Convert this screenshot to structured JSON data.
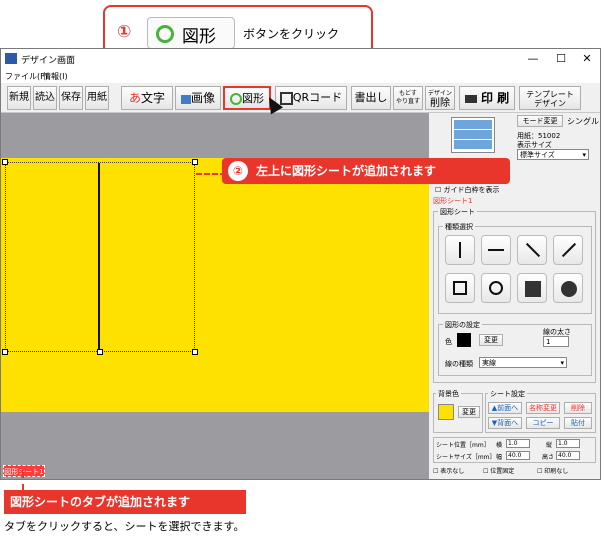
{
  "callout_top": {
    "num": "①",
    "button_label": "図形",
    "text": "ボタンをクリック"
  },
  "callout_mid": {
    "num": "②",
    "text": "左上に図形シートが追加されます"
  },
  "window": {
    "title": "デザイン画面",
    "controls": [
      "—",
      "☐",
      "✕"
    ]
  },
  "menu": {
    "file": "ファイル(F)",
    "info": "情報(I)"
  },
  "toolbar": {
    "new": "新規",
    "open": "読込",
    "save": "保存",
    "paper": "用紙",
    "text_prefix": "あ",
    "text": "文字",
    "image": "画像",
    "figure": "図形",
    "qr": "QRコード",
    "extract": "書出し",
    "back_top": "もどす",
    "back_bottom": "やり直す",
    "delete_top": "デザイン",
    "delete_bottom": "削除",
    "print": "印 刷",
    "template_top": "テンプレート",
    "template_bottom": "デザイン"
  },
  "panel": {
    "mode_button": "モード変更",
    "mode_value": "シングル",
    "paper_line": "用紙：51002",
    "display_size_label": "表示サイズ",
    "display_size_value": "標準サイズ",
    "guide_checkbox": "ガイド白枠を表示",
    "sheet_tab": "図形シート1",
    "figure_sheet": "図形シート",
    "type_select": "種類選択",
    "figure_settings": "図形の設定",
    "color_label": "色",
    "change": "変更",
    "line_width_label": "線の太さ",
    "line_width_value": "1",
    "line_type_label": "線の種類",
    "line_type_value": "実線",
    "bg_color": "背景色",
    "bg_change": "変更",
    "sheet_settings": "シート設定",
    "front": "▲前面へ",
    "back": "▼背面へ",
    "rename": "名称変更",
    "copy": "コピー",
    "delete": "削除",
    "paste": "貼付",
    "pos_label": "シート位置［mm］",
    "size_label": "シートサイズ［mm］",
    "x_label": "横",
    "x_value": "1.0",
    "y_label": "縦",
    "y_value": "1.0",
    "w_label": "幅",
    "w_value": "40.0",
    "h_label": "高さ",
    "h_value": "40.0",
    "hide": "表示なし",
    "fix_pos": "位置固定",
    "no_print": "印刷なし"
  },
  "bottom_tab": "図形シート1",
  "footer": {
    "highlight": "図形シートのタブが追加されます",
    "note": "タブをクリックすると、シートを選択できます。"
  },
  "colors": {
    "accent": "#e8362c",
    "sheet": "#ffe100",
    "canvas_bg": "#9c9ca0"
  }
}
